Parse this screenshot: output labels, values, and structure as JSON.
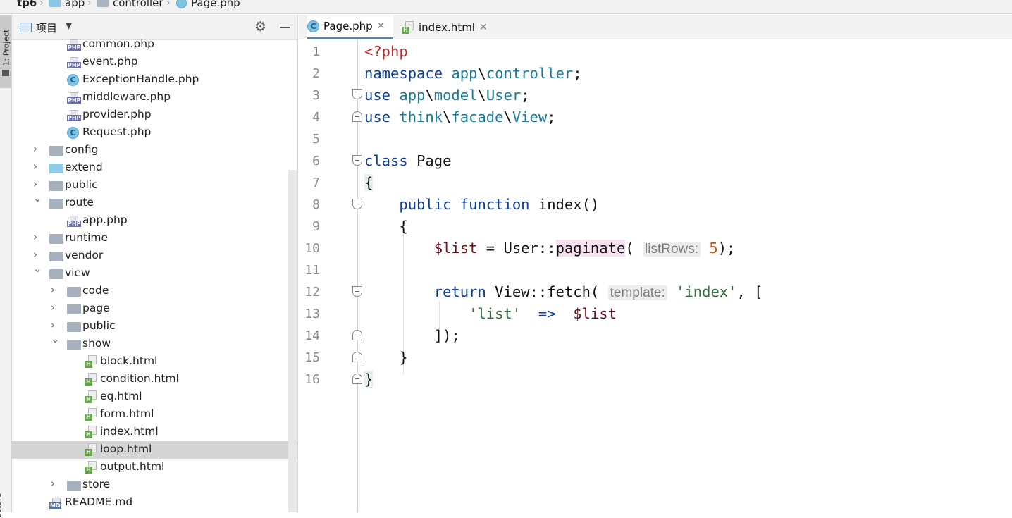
{
  "breadcrumb": [
    "tp6",
    "app",
    "controller",
    "Page.php"
  ],
  "tool_strip": {
    "project_label": "1: Project",
    "structure_label": "ucture"
  },
  "panel": {
    "title": "项目",
    "tree": [
      {
        "label": "common.php",
        "icon": "php-file-icon"
      },
      {
        "label": "event.php",
        "icon": "php-file-icon"
      },
      {
        "label": "ExceptionHandle.php",
        "icon": "class-file-icon"
      },
      {
        "label": "middleware.php",
        "icon": "php-file-icon"
      },
      {
        "label": "provider.php",
        "icon": "php-file-icon"
      },
      {
        "label": "Request.php",
        "icon": "class-file-icon"
      },
      {
        "label": "config",
        "icon": "folder-icon",
        "arrow": "collapsed"
      },
      {
        "label": "extend",
        "icon": "folder-blue-icon",
        "arrow": "collapsed"
      },
      {
        "label": "public",
        "icon": "folder-icon",
        "arrow": "collapsed"
      },
      {
        "label": "route",
        "icon": "folder-icon",
        "arrow": "expanded"
      },
      {
        "label": "app.php",
        "icon": "php-file-icon"
      },
      {
        "label": "runtime",
        "icon": "folder-icon",
        "arrow": "collapsed"
      },
      {
        "label": "vendor",
        "icon": "folder-icon",
        "arrow": "collapsed"
      },
      {
        "label": "view",
        "icon": "folder-icon",
        "arrow": "expanded"
      },
      {
        "label": "code",
        "icon": "folder-icon",
        "arrow": "collapsed"
      },
      {
        "label": "page",
        "icon": "folder-icon",
        "arrow": "collapsed"
      },
      {
        "label": "public",
        "icon": "folder-icon",
        "arrow": "collapsed"
      },
      {
        "label": "show",
        "icon": "folder-icon",
        "arrow": "expanded"
      },
      {
        "label": "block.html",
        "icon": "html-file-icon"
      },
      {
        "label": "condition.html",
        "icon": "html-file-icon"
      },
      {
        "label": "eq.html",
        "icon": "html-file-icon"
      },
      {
        "label": "form.html",
        "icon": "html-file-icon"
      },
      {
        "label": "index.html",
        "icon": "html-file-icon"
      },
      {
        "label": "loop.html",
        "icon": "html-file-icon",
        "selected": true
      },
      {
        "label": "output.html",
        "icon": "html-file-icon"
      },
      {
        "label": "store",
        "icon": "folder-icon",
        "arrow": "collapsed"
      },
      {
        "label": "README.md",
        "icon": "md-file-icon"
      }
    ]
  },
  "tabs": [
    {
      "label": "Page.php",
      "active": true
    },
    {
      "label": "index.html",
      "active": false
    }
  ],
  "editor": {
    "line_numbers": [
      "1",
      "2",
      "3",
      "4",
      "5",
      "6",
      "7",
      "8",
      "9",
      "10",
      "11",
      "12",
      "13",
      "14",
      "15",
      "16"
    ],
    "code": {
      "l1": "<?php",
      "l2_kw": "namespace",
      "l2_ns": "app",
      "l2_sep": "\\",
      "l2_ns2": "controller",
      "l2_end": ";",
      "l3_kw": "use",
      "l3_a": "app",
      "l3_b": "model",
      "l3_c": "User",
      "l4_kw": "use",
      "l4_a": "think",
      "l4_b": "facade",
      "l4_c": "View",
      "l6_kw": "class",
      "l6_name": "Page",
      "l7": "{",
      "l8_kw1": "public",
      "l8_kw2": "function",
      "l8_name": "index()",
      "l9": "{",
      "l10_var": "$list",
      "l10_eq": " = ",
      "l10_cls": "User",
      "l10_dc": "::",
      "l10_fn": "paginate",
      "l10_paren": "(",
      "l10_hint": "listRows:",
      "l10_num": "5",
      "l10_end": ");",
      "l12_kw": "return",
      "l12_cls": "View",
      "l12_dc": "::",
      "l12_fn": "fetch(",
      "l12_hint": "template:",
      "l12_str": "'index'",
      "l12_end": ", [",
      "l13_str": "'list'",
      "l13_arrow": "  =>  ",
      "l13_var": "$list",
      "l14": "]);",
      "l15": "}",
      "l16": "}"
    }
  }
}
